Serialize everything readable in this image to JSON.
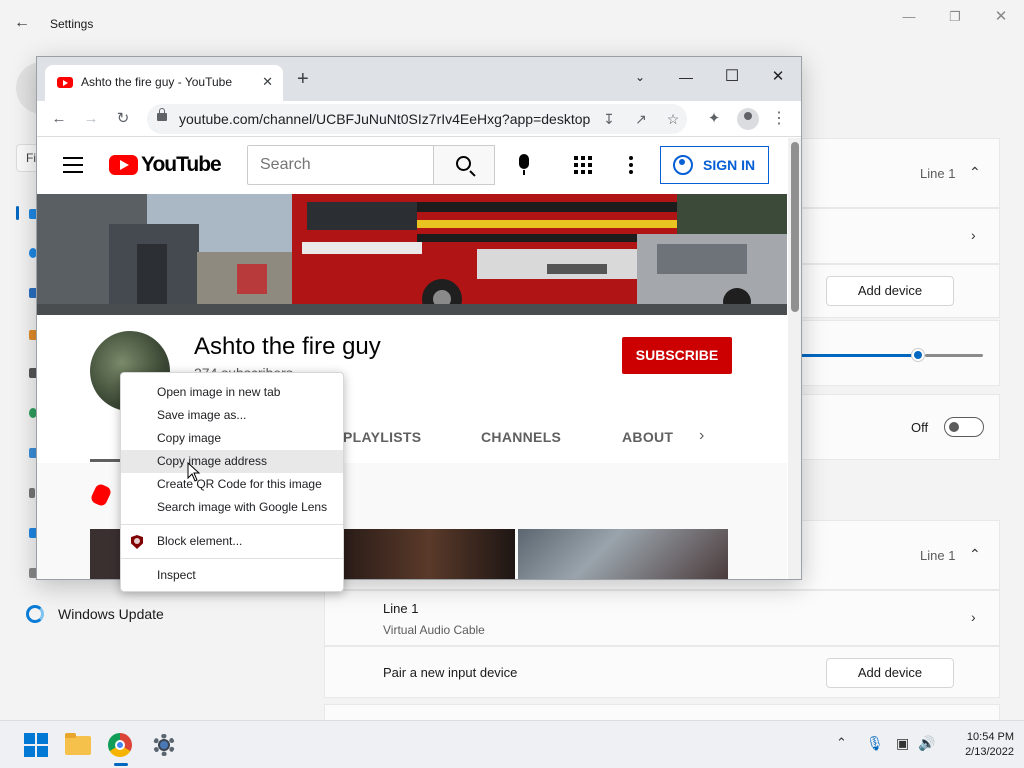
{
  "settings": {
    "title": "Settings",
    "search_placeholder": "Fi",
    "nav_windows_update": "Windows Update",
    "cards": {
      "output_line": "Line 1",
      "add_device": "Add device",
      "toggle_state": "Off",
      "input_line": "Line 1",
      "input_device_name": "Line 1",
      "input_device_sub": "Virtual Audio Cable",
      "pair_label": "Pair a new input device",
      "add_device_2": "Add device"
    },
    "slider_value": 0.75
  },
  "chrome": {
    "tab_title": "Ashto the fire guy - YouTube",
    "url": "youtube.com/channel/UCBFJuNuNt0SIz7rIv4EeHxg?app=desktop"
  },
  "youtube": {
    "logo_text": "YouTube",
    "search_placeholder": "Search",
    "signin_label": "SIGN IN",
    "channel_name": "Ashto the fire guy",
    "subscribers": "274 subscribers",
    "subscribe_label": "SUBSCRIBE",
    "tabs": [
      "PLAYLISTS",
      "CHANNELS",
      "ABOUT"
    ]
  },
  "context_menu": {
    "items": [
      "Open image in new tab",
      "Save image as...",
      "Copy image",
      "Copy image address",
      "Create QR Code for this image",
      "Search image with Google Lens",
      "Block element...",
      "Inspect"
    ],
    "highlighted_index": 3
  },
  "taskbar": {
    "time": "10:54 PM",
    "date": "2/13/2022"
  },
  "colors": {
    "youtube_red": "#ff0000",
    "subscribe_red": "#cc0000",
    "signin_blue": "#065fd4",
    "windows_accent": "#0067c0"
  }
}
